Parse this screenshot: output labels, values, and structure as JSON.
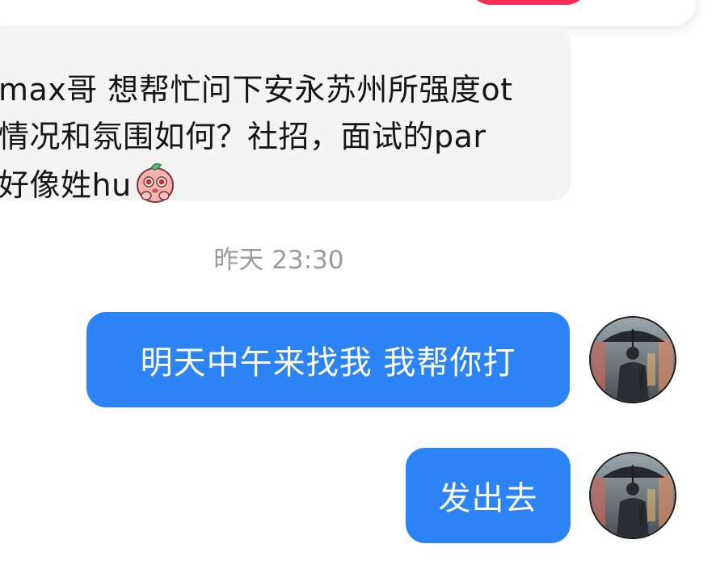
{
  "top_card": {
    "accent_color": "#fe2c55"
  },
  "messages": {
    "incoming": {
      "text": "max哥 想帮忙问下安永苏州所强度ot情况和氛围如何？社招，面试的par好像姓hu",
      "emoji": "pleading-peach-emoji"
    },
    "timestamp": "昨天 23:30",
    "outgoing": [
      {
        "text": "明天中午来找我 我帮你打",
        "avatar": "umbrella-man-avatar"
      },
      {
        "text": "发出去",
        "avatar": "umbrella-man-avatar"
      }
    ]
  },
  "colors": {
    "outgoing_bubble": "#2c83f6",
    "incoming_bubble": "#f4f4f4",
    "timestamp": "#9b9b9b"
  }
}
